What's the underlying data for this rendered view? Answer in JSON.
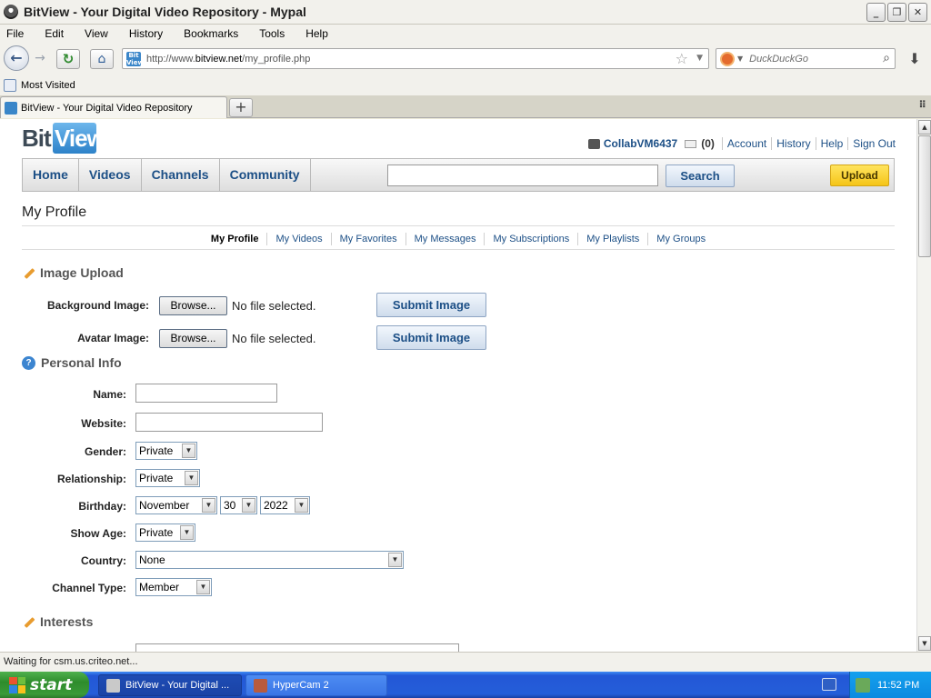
{
  "window": {
    "title": "BitView - Your Digital Video Repository - Mypal",
    "controls": {
      "minimize": "_",
      "maximize": "❐",
      "close": "✕"
    }
  },
  "menu": [
    "File",
    "Edit",
    "View",
    "History",
    "Bookmarks",
    "Tools",
    "Help"
  ],
  "toolbar": {
    "url_prefix": "http://www.",
    "url_domain": "bitview.net",
    "url_path": "/my_profile.php",
    "search_placeholder": "DuckDuckGo",
    "favicon_text": "Bit View"
  },
  "bookmarks": {
    "most_visited": "Most Visited"
  },
  "tabs": [
    {
      "label": "BitView - Your Digital Video Repository"
    }
  ],
  "site": {
    "logo_left": "Bit",
    "logo_right": "View",
    "username": "CollabVM6437",
    "message_count": "(0)",
    "user_links": [
      "Account",
      "History",
      "Help",
      "Sign Out"
    ],
    "nav": [
      "Home",
      "Videos",
      "Channels",
      "Community"
    ],
    "search_button": "Search",
    "upload_button": "Upload"
  },
  "page": {
    "title": "My Profile",
    "subnav": [
      "My Profile",
      "My Videos",
      "My Favorites",
      "My Messages",
      "My Subscriptions",
      "My Playlists",
      "My Groups"
    ]
  },
  "image_upload": {
    "heading": "Image Upload",
    "background_label": "Background Image:",
    "avatar_label": "Avatar Image:",
    "browse": "Browse...",
    "no_file": "No file selected.",
    "submit": "Submit Image"
  },
  "personal_info": {
    "heading": "Personal Info",
    "name_label": "Name:",
    "name_value": "",
    "website_label": "Website:",
    "website_value": "",
    "gender_label": "Gender:",
    "gender_value": "Private",
    "relationship_label": "Relationship:",
    "relationship_value": "Private",
    "birthday_label": "Birthday:",
    "birthday_month": "November",
    "birthday_day": "30",
    "birthday_year": "2022",
    "show_age_label": "Show Age:",
    "show_age_value": "Private",
    "country_label": "Country:",
    "country_value": "None",
    "channel_type_label": "Channel Type:",
    "channel_type_value": "Member"
  },
  "interests": {
    "heading": "Interests"
  },
  "status_bar": "Waiting for csm.us.criteo.net...",
  "taskbar": {
    "start": "start",
    "items": [
      "BitView - Your Digital ...",
      "HyperCam 2"
    ],
    "clock": "11:52 PM"
  }
}
